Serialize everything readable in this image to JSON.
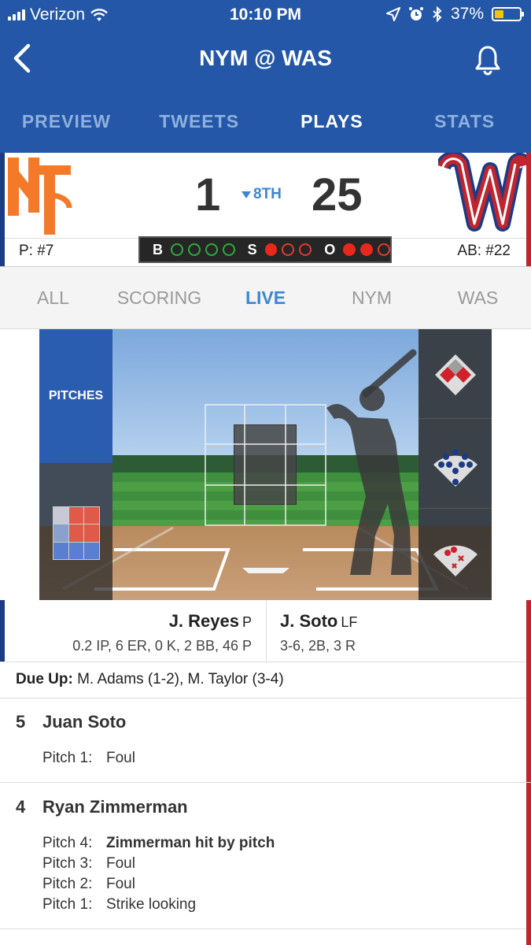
{
  "status_bar": {
    "carrier": "Verizon",
    "time": "10:10 PM",
    "battery": "37%",
    "battery_level": 0.37,
    "icons": [
      "signal-icon",
      "wifi-icon",
      "location-icon",
      "alarm-icon",
      "bluetooth-icon",
      "battery-icon"
    ]
  },
  "nav": {
    "title": "NYM @ WAS",
    "icons": [
      "back-chevron-icon",
      "bell-icon"
    ]
  },
  "tabs": [
    {
      "label": "PREVIEW",
      "active": false
    },
    {
      "label": "TWEETS",
      "active": false
    },
    {
      "label": "PLAYS",
      "active": true
    },
    {
      "label": "STATS",
      "active": false
    }
  ],
  "scoreboard": {
    "away_score": "1",
    "home_score": "25",
    "inning": "8TH",
    "inning_half": "bottom",
    "pitcher": "P: #7",
    "batter": "AB: #22",
    "count": {
      "balls_label": "B",
      "strikes_label": "S",
      "outs_label": "O",
      "balls": 0,
      "strikes": 1,
      "outs": 2
    },
    "colors": {
      "away_primary": "#1b3b86",
      "away_logo": "#f47a2a",
      "home_primary": "#c0242e",
      "home_logo_outline": "#1b3b86"
    }
  },
  "subtabs": [
    {
      "label": "ALL",
      "active": false
    },
    {
      "label": "SCORING",
      "active": false
    },
    {
      "label": "LIVE",
      "active": true
    },
    {
      "label": "NYM",
      "active": false
    },
    {
      "label": "WAS",
      "active": false
    }
  ],
  "field": {
    "pitches_label": "PITCHES"
  },
  "matchup": {
    "pitcher_name": "J. Reyes",
    "pitcher_pos": "P",
    "pitcher_stats": "0.2 IP, 6 ER, 0 K, 2 BB, 46 P",
    "batter_name": "J. Soto",
    "batter_pos": "LF",
    "batter_stats": "3-6, 2B, 3 R"
  },
  "due_up": {
    "label": "Due Up:",
    "text": "M. Adams (1-2), M. Taylor (3-4)"
  },
  "plays": [
    {
      "num": "5",
      "name": "Juan Soto",
      "pitches": [
        {
          "label": "Pitch 1:",
          "result": "Foul",
          "bold": false
        }
      ]
    },
    {
      "num": "4",
      "name": "Ryan Zimmerman",
      "pitches": [
        {
          "label": "Pitch 4:",
          "result": "Zimmerman hit by pitch",
          "bold": true
        },
        {
          "label": "Pitch 3:",
          "result": "Foul",
          "bold": false
        },
        {
          "label": "Pitch 2:",
          "result": "Foul",
          "bold": false
        },
        {
          "label": "Pitch 1:",
          "result": "Strike looking",
          "bold": false
        }
      ]
    }
  ]
}
